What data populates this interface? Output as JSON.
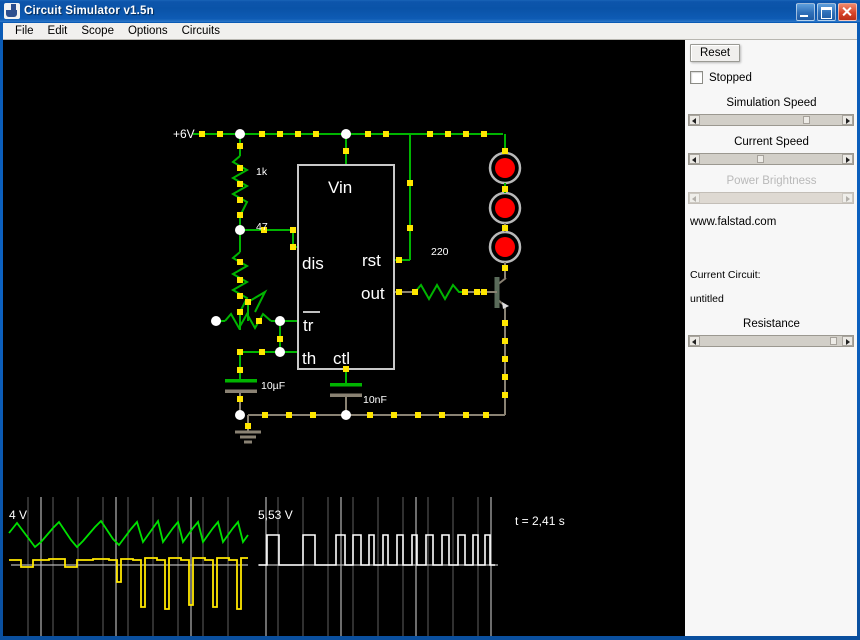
{
  "window": {
    "title": "Circuit Simulator v1.5n",
    "icon": "java-coffee-cup-icon",
    "buttons": {
      "minimize": "minimize-icon",
      "maximize": "maximize-icon",
      "close": "close-icon"
    }
  },
  "menubar": {
    "items": [
      "File",
      "Edit",
      "Scope",
      "Options",
      "Circuits"
    ]
  },
  "panel": {
    "reset_label": "Reset",
    "stopped_label": "Stopped",
    "stopped_checked": false,
    "sliders": [
      {
        "label": "Simulation Speed",
        "value_pct": 71,
        "enabled": true
      },
      {
        "label": "Current Speed",
        "value_pct": 38,
        "enabled": true
      },
      {
        "label": "Power Brightness",
        "value_pct": 0,
        "enabled": false
      }
    ],
    "website": "www.falstad.com",
    "current_circuit_label": "Current Circuit:",
    "current_circuit_name": "untitled",
    "resistance_label": "Resistance",
    "resistance_value_pct": 88
  },
  "circuit": {
    "supply_label": "+6V",
    "ic": {
      "name": "555-timer",
      "pins": {
        "vin": "Vin",
        "dis": "dis",
        "rst": "rst",
        "out": "out",
        "tr": "tr",
        "th": "th",
        "ctl": "ctl"
      }
    },
    "components": [
      {
        "name": "resistor-1k",
        "label": "1k"
      },
      {
        "name": "resistor-47",
        "label": "47"
      },
      {
        "name": "resistor-220",
        "label": "220"
      },
      {
        "name": "capacitor-10uF",
        "label": "10µF"
      },
      {
        "name": "capacitor-10nF",
        "label": "10nF"
      }
    ],
    "led_count": 3,
    "led_color": "#ff0000",
    "wire_color_live": "#00c000",
    "wire_color_dead": "#8a8273",
    "node_color": "#ffe600"
  },
  "scopes": [
    {
      "name": "scope-capacitor",
      "label": "4 V",
      "traces": [
        {
          "color": "#00e000",
          "name": "capacitor-voltage-sawtooth"
        },
        {
          "color": "#ffe800",
          "name": "current-trace"
        }
      ]
    },
    {
      "name": "scope-output",
      "label": "5,53 V",
      "traces": [
        {
          "color": "#ffffff",
          "name": "output-pulse-train"
        }
      ]
    }
  ],
  "status": {
    "time_label": "t = 2,41 s"
  },
  "colors": {
    "titlebar": "#0a53a8",
    "panel_bg": "#f7f7f7",
    "canvas_bg": "#000000",
    "accent_green": "#00c000",
    "accent_yellow": "#ffe600",
    "led_red": "#ff0000"
  }
}
